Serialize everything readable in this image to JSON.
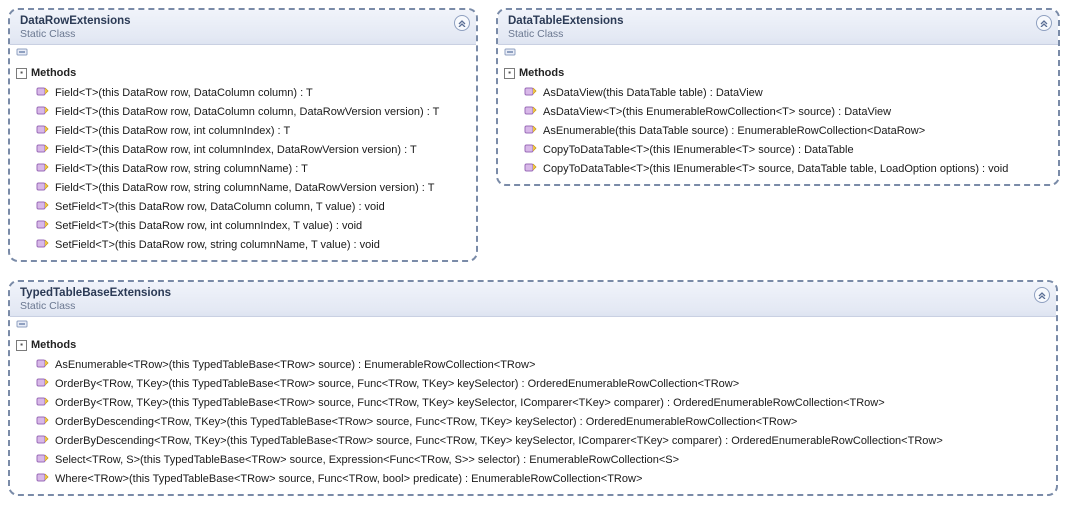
{
  "icons": {
    "section_toggle": "▪",
    "collapse_double_chevron": "collapse"
  },
  "classes": [
    {
      "name": "DataRowExtensions",
      "stereotype": "Static Class",
      "section_label": "Methods",
      "methods": [
        "Field<T>(this DataRow row, DataColumn column) : T",
        "Field<T>(this DataRow row, DataColumn column, DataRowVersion version) : T",
        "Field<T>(this DataRow row, int columnIndex) : T",
        "Field<T>(this DataRow row, int columnIndex, DataRowVersion version) : T",
        "Field<T>(this DataRow row, string columnName) : T",
        "Field<T>(this DataRow row, string columnName, DataRowVersion version) : T",
        "SetField<T>(this DataRow row, DataColumn column, T value) : void",
        "SetField<T>(this DataRow row, int columnIndex, T value) : void",
        "SetField<T>(this DataRow row, string columnName, T value) : void"
      ]
    },
    {
      "name": "DataTableExtensions",
      "stereotype": "Static Class",
      "section_label": "Methods",
      "methods": [
        "AsDataView(this DataTable table) : DataView",
        "AsDataView<T>(this EnumerableRowCollection<T> source) : DataView",
        "AsEnumerable(this DataTable source) : EnumerableRowCollection<DataRow>",
        "CopyToDataTable<T>(this IEnumerable<T> source) : DataTable",
        "CopyToDataTable<T>(this IEnumerable<T> source, DataTable table, LoadOption options) : void"
      ]
    },
    {
      "name": "TypedTableBaseExtensions",
      "stereotype": "Static Class",
      "section_label": "Methods",
      "methods": [
        "AsEnumerable<TRow>(this TypedTableBase<TRow> source) : EnumerableRowCollection<TRow>",
        "OrderBy<TRow, TKey>(this TypedTableBase<TRow> source, Func<TRow, TKey> keySelector) : OrderedEnumerableRowCollection<TRow>",
        "OrderBy<TRow, TKey>(this TypedTableBase<TRow> source, Func<TRow, TKey> keySelector, IComparer<TKey> comparer) : OrderedEnumerableRowCollection<TRow>",
        "OrderByDescending<TRow, TKey>(this TypedTableBase<TRow> source, Func<TRow, TKey> keySelector) : OrderedEnumerableRowCollection<TRow>",
        "OrderByDescending<TRow, TKey>(this TypedTableBase<TRow> source, Func<TRow, TKey> keySelector, IComparer<TKey> comparer) : OrderedEnumerableRowCollection<TRow>",
        "Select<TRow, S>(this TypedTableBase<TRow> source, Expression<Func<TRow, S>> selector) : EnumerableRowCollection<S>",
        "Where<TRow>(this TypedTableBase<TRow> source, Func<TRow, bool> predicate) : EnumerableRowCollection<TRow>"
      ]
    }
  ]
}
